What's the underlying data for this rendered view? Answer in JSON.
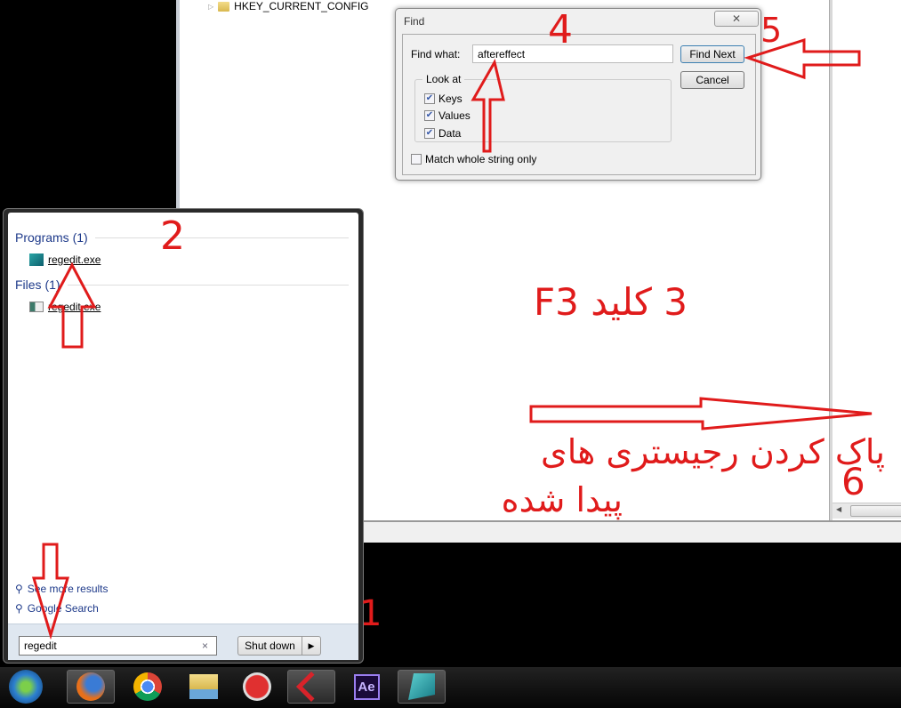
{
  "regedit": {
    "tree_item": "HKEY_CURRENT_CONFIG"
  },
  "find_dialog": {
    "title": "Find",
    "close_label": "✕",
    "find_what_label": "Find what:",
    "find_what_value": "aftereffect",
    "look_at_label": "Look at",
    "keys_label": "Keys",
    "keys_checked": true,
    "values_label": "Values",
    "values_checked": true,
    "data_label": "Data",
    "data_checked": true,
    "match_whole_label": "Match whole string only",
    "match_whole_checked": false,
    "find_next_label": "Find Next",
    "cancel_label": "Cancel"
  },
  "start_menu": {
    "programs_header": "Programs (1)",
    "program_result": "regedit.exe",
    "files_header": "Files (1)",
    "file_result": "regedit.exe",
    "see_more": "See more results",
    "google_search": "Google Search",
    "search_value": "regedit",
    "clear_icon": "×",
    "shutdown_label": "Shut down",
    "shutdown_arrow": "▶"
  },
  "taskbar": {
    "items": [
      "start-orb",
      "firefox",
      "chrome",
      "windows-explorer",
      "app-red-circle",
      "cubase",
      "after-effects",
      "regedit"
    ],
    "ae_label": "Ae"
  },
  "annotations": {
    "step1": "1",
    "step2": "2",
    "step3": "3 کلید F3",
    "step4": "4",
    "step5": "5",
    "step6": "6",
    "note_line1": "پاک کردن رجیستری های",
    "note_line2": "پیدا شده",
    "color": "#e01b1b"
  }
}
